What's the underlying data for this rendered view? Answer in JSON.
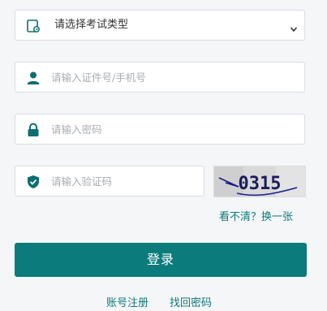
{
  "exam_type": {
    "selected": "请选择考试类型",
    "icon": "exam-type-icon"
  },
  "id_field": {
    "placeholder": "请输入证件号/手机号",
    "value": "",
    "icon": "user-icon"
  },
  "password_field": {
    "placeholder": "请输入密码",
    "value": "",
    "icon": "lock-icon"
  },
  "captcha_field": {
    "placeholder": "请输入验证码",
    "value": "",
    "icon": "shield-check-icon"
  },
  "captcha_image": {
    "code": "0315"
  },
  "refresh_captcha_label": "看不清？换一张",
  "login_button_label": "登录",
  "links": {
    "register": "账号注册",
    "recover_password": "找回密码"
  },
  "colors": {
    "primary": "#0b7b7c",
    "link": "#0d7a7a",
    "icon": "#0d6e70",
    "background": "#f5f6f8"
  }
}
